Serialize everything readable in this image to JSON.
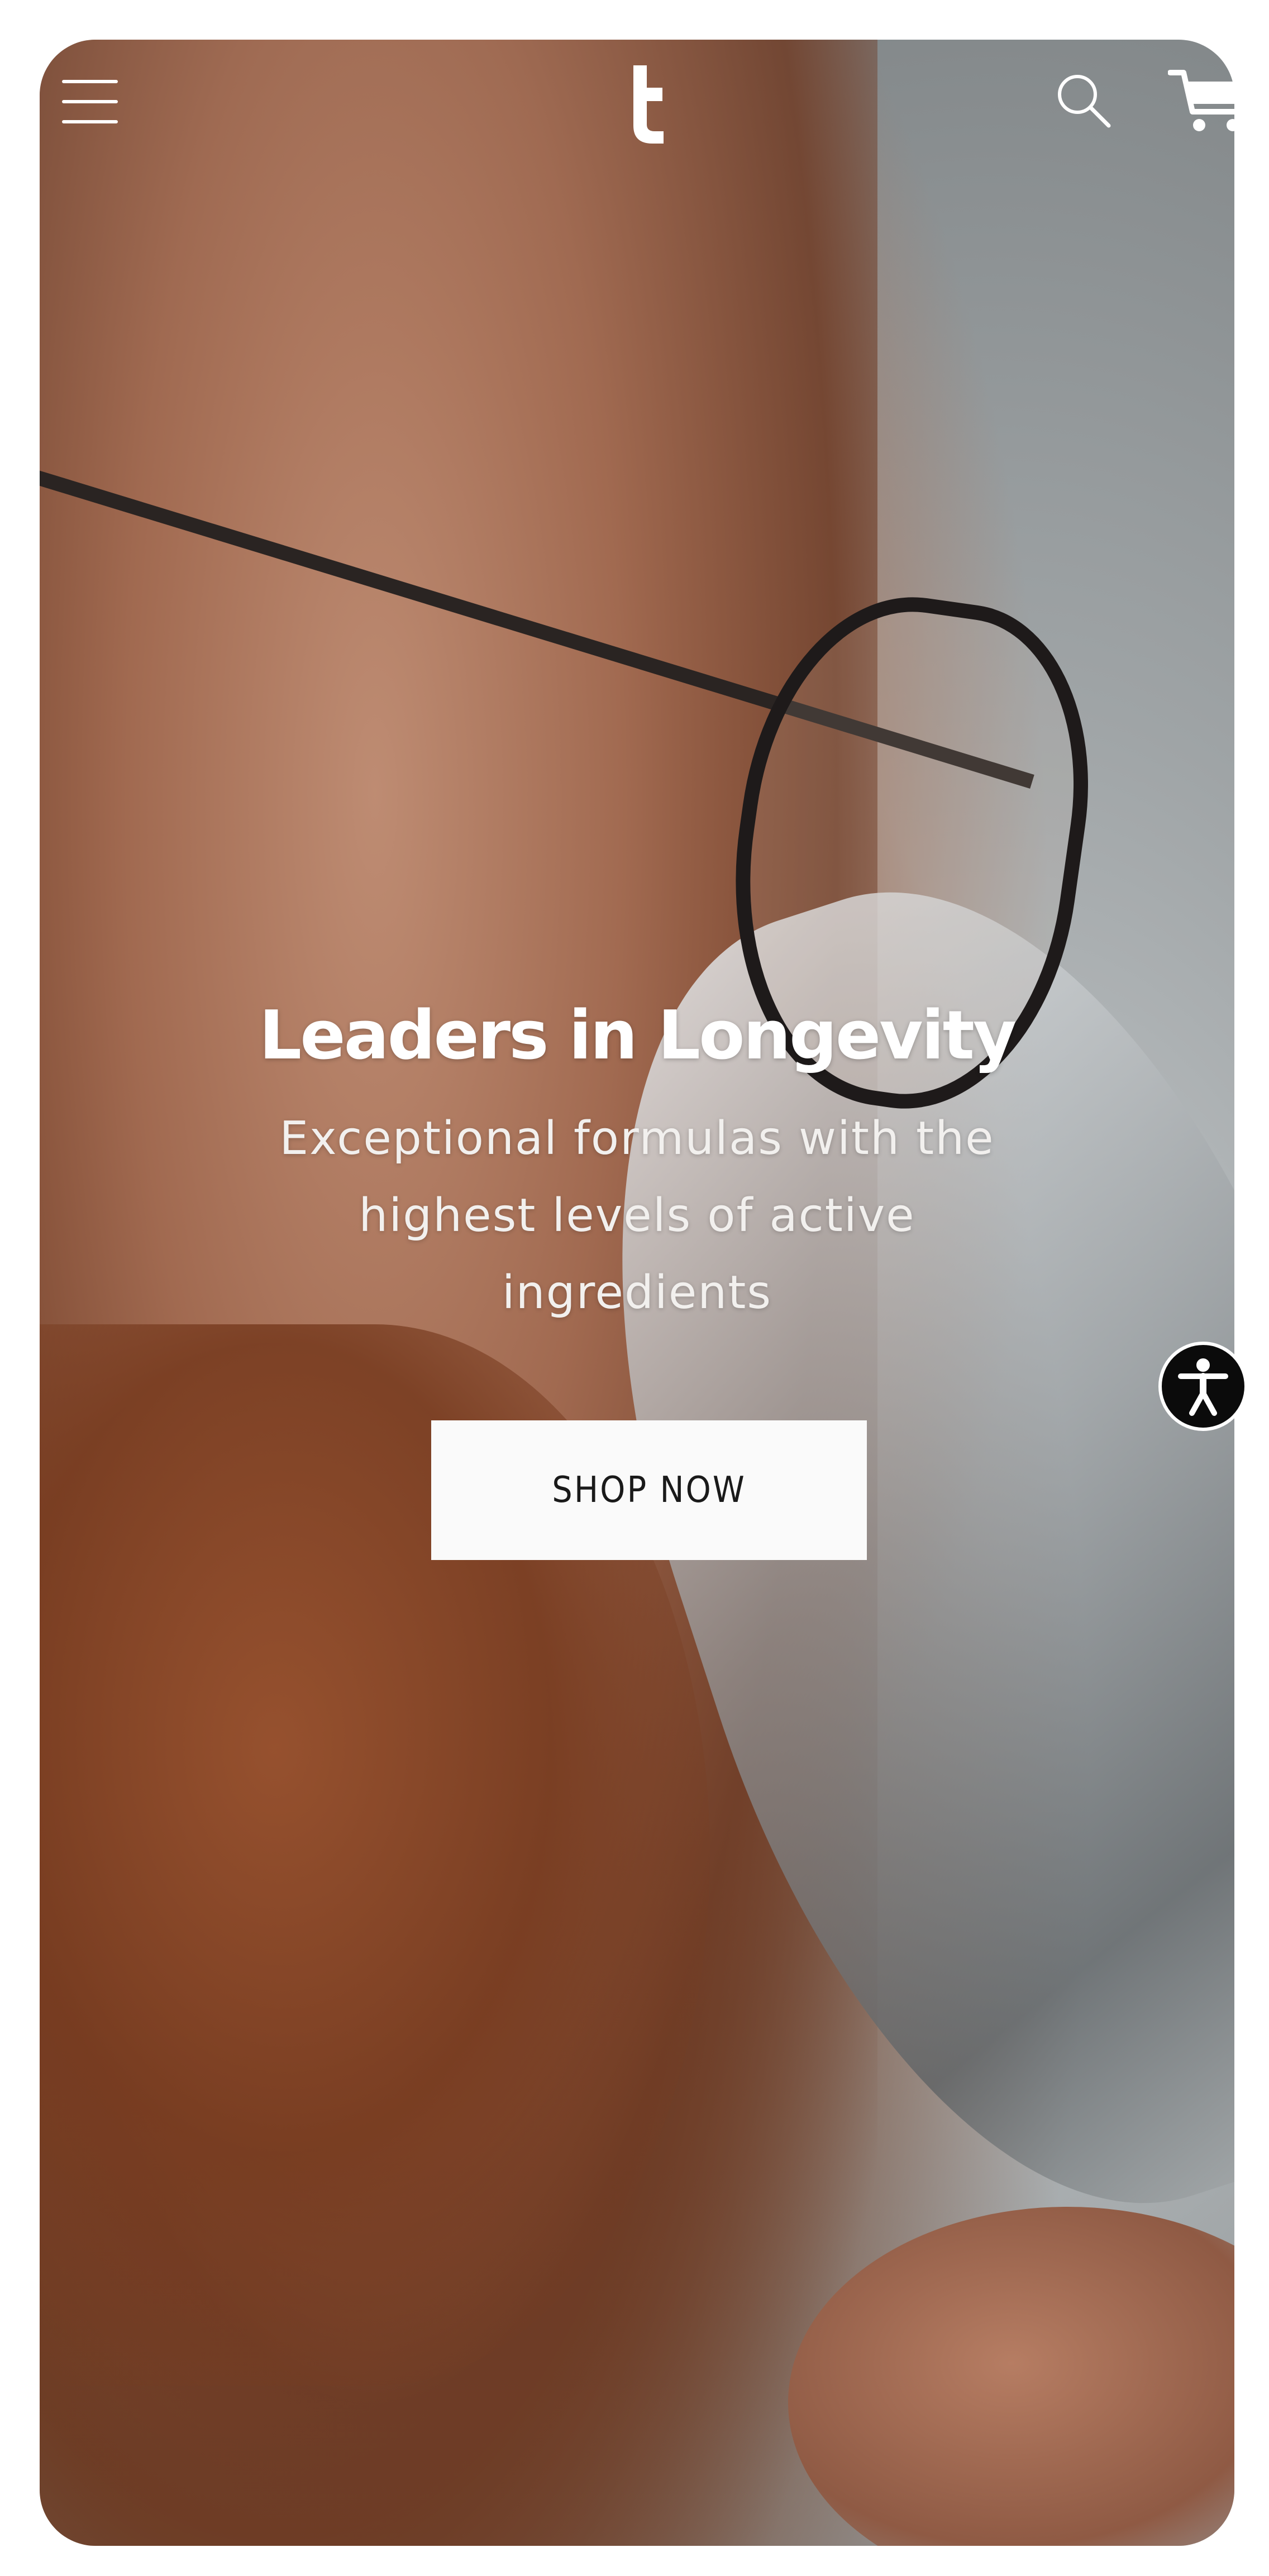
{
  "header": {
    "menu_icon": "hamburger-menu-icon",
    "logo_icon": "t-logo-icon",
    "search_icon": "search-icon",
    "cart_icon": "shopping-cart-icon"
  },
  "hero": {
    "title": "Leaders in Longevity",
    "subtitle": "Exceptional formulas with the highest levels of active ingredients",
    "cta_label": "SHOP NOW"
  },
  "accessibility": {
    "icon": "accessibility-person-icon"
  },
  "colors": {
    "text_on_hero": "#ffffff",
    "cta_background": "#fafafa",
    "cta_text": "#1a1a1a",
    "accessibility_button": "#0b0b0b"
  }
}
